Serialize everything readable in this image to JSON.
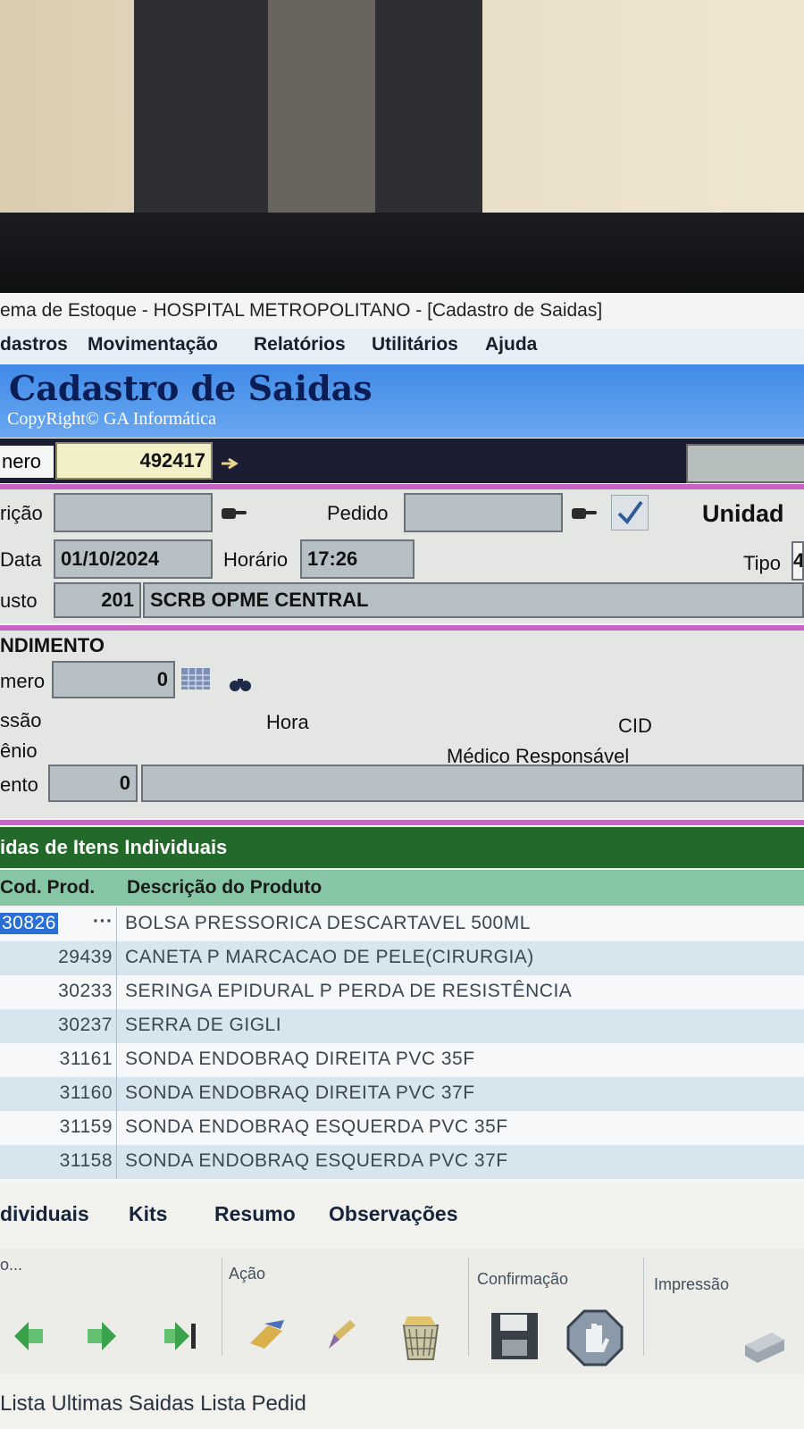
{
  "window": {
    "title": "ema de Estoque - HOSPITAL METROPOLITANO - [Cadastro de Saidas]"
  },
  "menu": [
    "dastros",
    "Movimentação",
    "Relatórios",
    "Utilitários",
    "Ajuda"
  ],
  "header": {
    "title": "Cadastro de Saidas",
    "copyright": "CopyRight© GA Informática"
  },
  "numero": {
    "label": "nero",
    "value": "492417"
  },
  "form": {
    "requisicao_label": "rição",
    "requisicao_value": "",
    "pedido_label": "Pedido",
    "pedido_value": "",
    "unidade_label": "Unidad",
    "data_label": "Data",
    "data_value": "01/10/2024",
    "horario_label": "Horário",
    "horario_value": "17:26",
    "tipo_label": "Tipo",
    "tipo_value": "4",
    "custo_label": "usto",
    "custo_code": "201",
    "custo_name": "SCRB OPME CENTRAL"
  },
  "atendimento": {
    "section_label": "NDIMENTO",
    "numero_label": "mero",
    "numero_value": "0",
    "admissao_label": "ssão",
    "hora_label": "Hora",
    "cid_label": "CID",
    "convenio_label": "ênio",
    "medico_label": "Médico Responsável",
    "procedimento_label": "ento",
    "procedimento_value": "0",
    "procedimento_desc": ""
  },
  "items": {
    "section_title": "idas de Itens Individuais",
    "columns": [
      "Cod. Prod.",
      "Descrição do Produto"
    ],
    "rows": [
      {
        "code": "30826",
        "desc": "BOLSA PRESSORICA DESCARTAVEL 500ML"
      },
      {
        "code": "29439",
        "desc": "CANETA P MARCACAO DE PELE(CIRURGIA)"
      },
      {
        "code": "30233",
        "desc": "SERINGA EPIDURAL P PERDA DE RESISTÊNCIA"
      },
      {
        "code": "30237",
        "desc": "SERRA DE GIGLI"
      },
      {
        "code": "31161",
        "desc": "SONDA ENDOBRAQ DIREITA PVC 35F"
      },
      {
        "code": "31160",
        "desc": "SONDA ENDOBRAQ DIREITA PVC 37F"
      },
      {
        "code": "31159",
        "desc": "SONDA ENDOBRAQ ESQUERDA PVC 35F"
      },
      {
        "code": "31158",
        "desc": "SONDA ENDOBRAQ ESQUERDA PVC 37F"
      }
    ],
    "selected_row": 0,
    "ellipsis": "···"
  },
  "tabs": [
    "dividuais",
    "Kits",
    "Resumo",
    "Observações"
  ],
  "toolbar": {
    "navegacao_label": "o...",
    "acao_label": "Ação",
    "confirmacao_label": "Confirmação",
    "impressao_label": "Impressão"
  },
  "footer": {
    "links": "Lista Ultimas Saidas   Lista Pedid"
  },
  "colors": {
    "header_blue": "#3f8ae8",
    "menu_text": "#15202c",
    "separator": "#c863c6",
    "section_green": "#236a2a",
    "column_green": "#87c6a5",
    "selection": "#2a6fd6"
  }
}
